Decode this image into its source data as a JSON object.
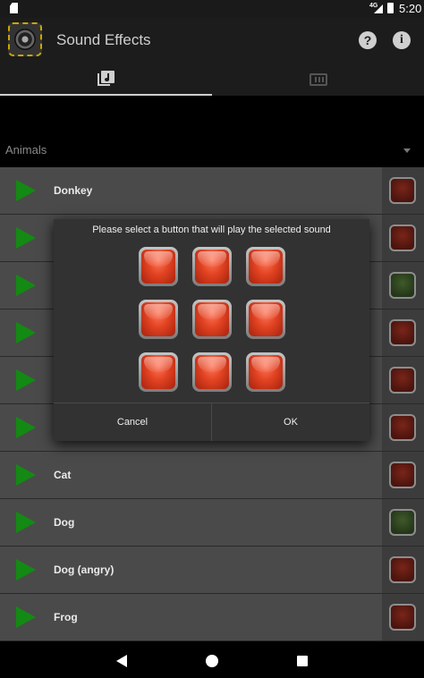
{
  "status_bar": {
    "network": "4G",
    "time": "5:20"
  },
  "app_bar": {
    "title": "Sound Effects",
    "help_icon": "?",
    "info_icon": "i"
  },
  "tabs": [
    {
      "name": "sounds",
      "icon": "music-library-icon",
      "selected": true
    },
    {
      "name": "keyboard",
      "icon": "keyboard-icon",
      "selected": false
    }
  ],
  "category": {
    "selected": "Animals"
  },
  "sounds": [
    {
      "label": "Donkey",
      "button": "red"
    },
    {
      "label": "",
      "button": "red"
    },
    {
      "label": "",
      "button": "green"
    },
    {
      "label": "",
      "button": "red"
    },
    {
      "label": "",
      "button": "red"
    },
    {
      "label": "",
      "button": "red"
    },
    {
      "label": "Cat",
      "button": "red"
    },
    {
      "label": "Dog",
      "button": "green"
    },
    {
      "label": "Dog (angry)",
      "button": "red"
    },
    {
      "label": "Frog",
      "button": "red"
    }
  ],
  "dialog": {
    "prompt": "Please select a button that will play the selected sound",
    "buttons_count": 9,
    "cancel_label": "Cancel",
    "ok_label": "OK"
  },
  "colors": {
    "play_green": "#138a13",
    "pad_red": "#e24322",
    "dialog_bg": "#323232",
    "row_bg": "#4a4a4a"
  }
}
